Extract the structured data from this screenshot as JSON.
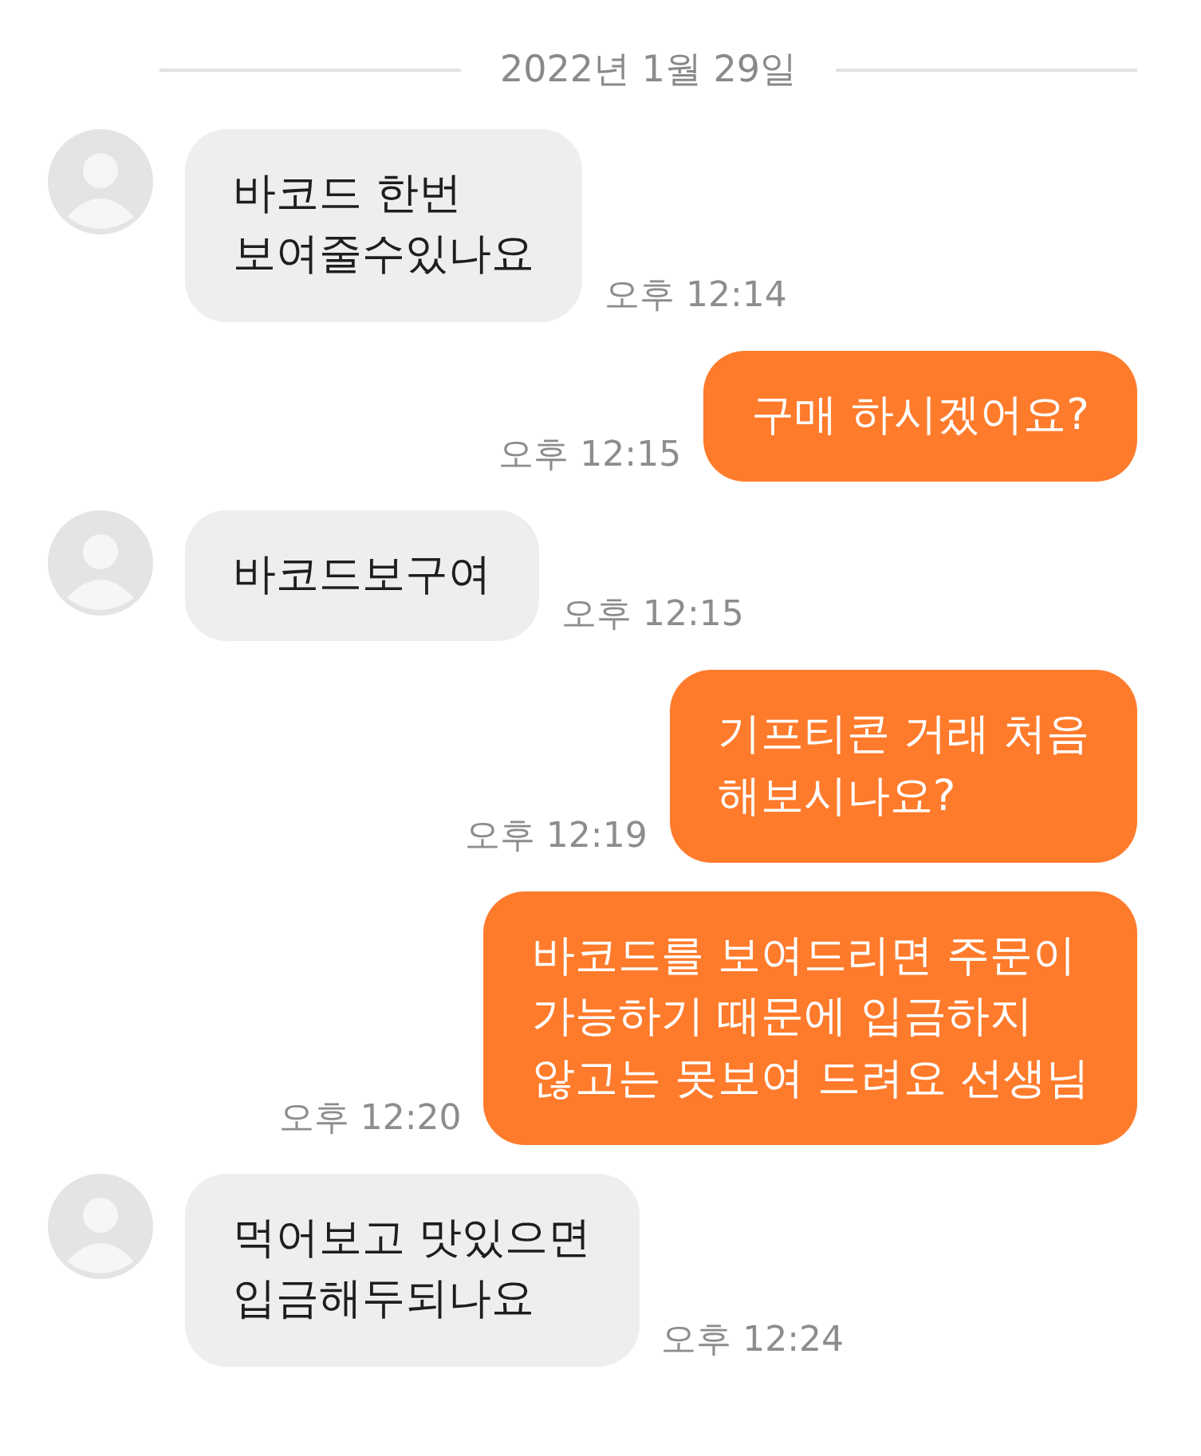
{
  "date_divider": "2022년 1월 29일",
  "messages": [
    {
      "kind": "incoming",
      "text": "바코드 한번\n보여줄수있나요",
      "time": "오후 12:14"
    },
    {
      "kind": "outgoing",
      "text": "구매 하시겠어요?",
      "time": "오후 12:15"
    },
    {
      "kind": "incoming",
      "text": "바코드보구여",
      "time": "오후 12:15"
    },
    {
      "kind": "outgoing",
      "text": "기프티콘 거래 처음\n해보시나요?",
      "time": "오후 12:19"
    },
    {
      "kind": "outgoing",
      "text": "바코드를 보여드리면 주문이\n가능하기 때문에 입금하지\n않고는 못보여 드려요 선생님",
      "time": "오후 12:20"
    },
    {
      "kind": "incoming",
      "text": "먹어보고 맛있으면\n입금해두되나요",
      "time": "오후 12:24"
    }
  ]
}
